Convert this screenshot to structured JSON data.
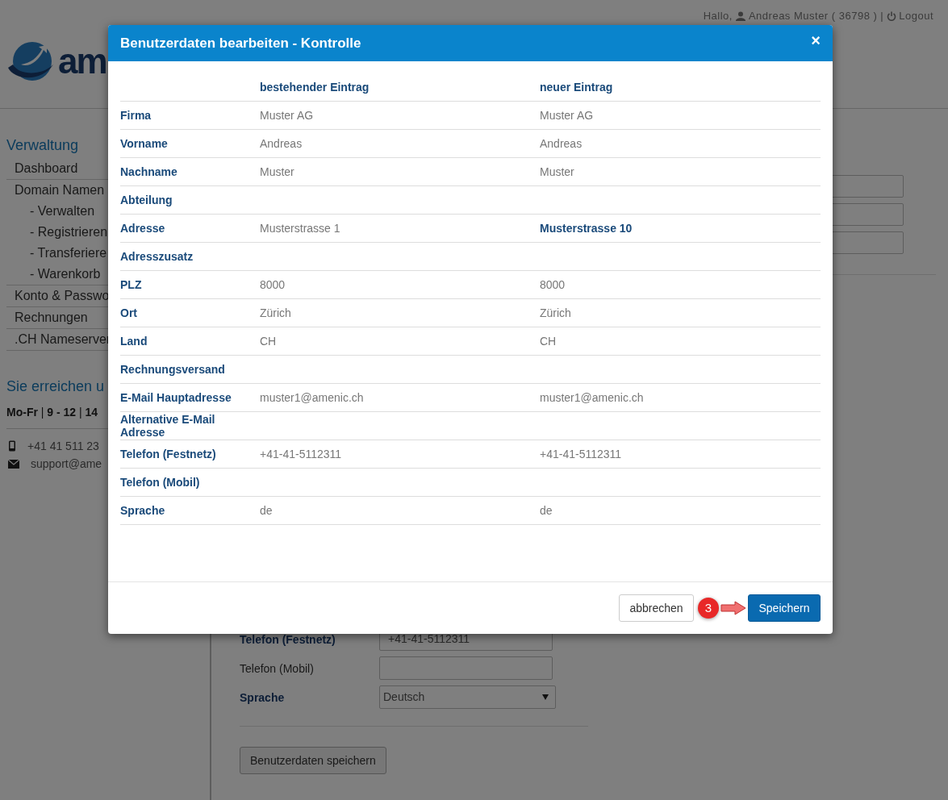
{
  "header": {
    "logo_text": "am",
    "greeting": "Hallo,",
    "user": "Andreas Muster ( 36798 )",
    "separator": "|",
    "logout": "Logout"
  },
  "sidebar": {
    "title": "Verwaltung",
    "items": [
      {
        "label": "Dashboard"
      },
      {
        "label": "Domain Namen",
        "children": [
          {
            "label": "- Verwalten"
          },
          {
            "label": "- Registrieren"
          },
          {
            "label": "- Transferiere"
          },
          {
            "label": "- Warenkorb"
          }
        ]
      },
      {
        "label": "Konto & Passwo"
      },
      {
        "label": "Rechnungen"
      },
      {
        "label": ".CH Nameserver"
      }
    ],
    "contact": {
      "title": "Sie erreichen u",
      "hours": "**Mo-Fr** | **9 - 12** | **14**",
      "phone": "+41 41 511 23",
      "email": "support@ame"
    }
  },
  "form": {
    "rows": [
      {
        "label": "Telefon (Festnetz)",
        "required": true,
        "kind": "input",
        "value": "+41-41-5112311"
      },
      {
        "label": "Telefon (Mobil)",
        "required": false,
        "kind": "input"
      },
      {
        "label": "Sprache",
        "required": true,
        "kind": "select",
        "value": "Deutsch"
      }
    ],
    "submit": "Benutzerdaten speichern"
  },
  "dialog": {
    "title": "Benutzerdaten bearbeiten - Kontrolle",
    "close": "×",
    "columns": {
      "old": "bestehender Eintrag",
      "new": "neuer Eintrag"
    },
    "rows": [
      {
        "label": "Firma",
        "old": "Muster AG",
        "new": "Muster AG",
        "changed": false
      },
      {
        "label": "Vorname",
        "old": "Andreas",
        "new": "Andreas",
        "changed": false
      },
      {
        "label": "Nachname",
        "old": "Muster",
        "new": "Muster",
        "changed": false
      },
      {
        "label": "Abteilung"
      },
      {
        "label": "Adresse",
        "old": "Musterstrasse 1",
        "new": "Musterstrasse 10",
        "changed": true
      },
      {
        "label": "Adresszusatz"
      },
      {
        "label": "PLZ",
        "old": "8000",
        "new": "8000",
        "changed": false
      },
      {
        "label": "Ort",
        "old": "Zürich",
        "new": "Zürich",
        "changed": false
      },
      {
        "label": "Land",
        "old": "CH",
        "new": "CH",
        "changed": false
      },
      {
        "label": "Rechnungsversand"
      },
      {
        "label": "E-Mail Hauptadresse",
        "old": "muster1@amenic.ch",
        "new": "muster1@amenic.ch",
        "changed": false
      },
      {
        "label": "Alternative E-Mail Adresse"
      },
      {
        "label": "Telefon (Festnetz)",
        "old": "+41-41-5112311",
        "new": "+41-41-5112311",
        "changed": false
      },
      {
        "label": "Telefon (Mobil)"
      },
      {
        "label": "Sprache",
        "old": "de",
        "new": "de",
        "changed": false
      }
    ],
    "cancel": "abbrechen",
    "save": "Speichern",
    "step_badge": "3"
  }
}
